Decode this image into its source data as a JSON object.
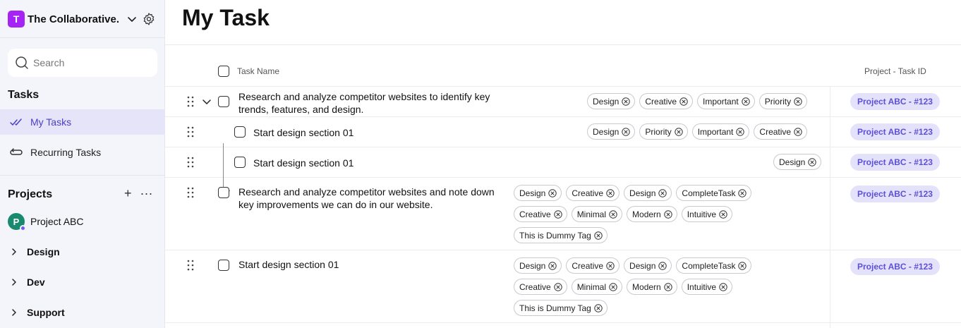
{
  "sidebar": {
    "workspace": {
      "initial": "T",
      "name": "The Collaborative..."
    },
    "search": {
      "placeholder": "Search"
    },
    "tasks_title": "Tasks",
    "nav": [
      {
        "label": "My Tasks",
        "icon": "double-check-icon",
        "active": true
      },
      {
        "label": "Recurring Tasks",
        "icon": "repeat-icon",
        "active": false
      }
    ],
    "projects_title": "Projects",
    "project": {
      "initial": "P",
      "name": "Project ABC"
    },
    "folders": [
      {
        "label": "Design"
      },
      {
        "label": "Dev"
      },
      {
        "label": "Support"
      }
    ]
  },
  "main": {
    "title": "My Task",
    "columns": {
      "task_name": "Task Name",
      "project_task_id": "Project - Task ID"
    },
    "rows": [
      {
        "name_lines": [
          "Research and analyze competitor websites to identify key",
          "trends, features, and design."
        ],
        "tags": [
          "Design",
          "Creative",
          "Important",
          "Priority"
        ],
        "project_id": "Project ABC - #123"
      },
      {
        "name_lines": [
          "Start design section 01"
        ],
        "tags": [
          "Design",
          "Priority",
          "Important",
          "Creative"
        ],
        "project_id": "Project ABC - #123"
      },
      {
        "name_lines": [
          "Start design section 01"
        ],
        "tags": [
          "Design"
        ],
        "project_id": "Project ABC - #123"
      },
      {
        "name_lines": [
          "Research and analyze competitor websites and note down",
          "key improvements we can do in our website."
        ],
        "tags": [
          "Design",
          "Creative",
          "Design",
          "CompleteTask",
          "Creative",
          "Minimal",
          "Modern",
          "Intuitive",
          "This is Dummy Tag"
        ],
        "project_id": "Project ABC - #123"
      },
      {
        "name_lines": [
          "Start design section 01"
        ],
        "tags": [
          "Design",
          "Creative",
          "Design",
          "CompleteTask",
          "Creative",
          "Minimal",
          "Modern",
          "Intuitive",
          "This is Dummy Tag"
        ],
        "project_id": "Project ABC - #123"
      }
    ]
  },
  "colors": {
    "accent": "#5c50d6",
    "workspace_avatar": "#a523f5",
    "project_avatar": "#1a8a6e",
    "active_nav_bg": "#e6e4f8"
  }
}
